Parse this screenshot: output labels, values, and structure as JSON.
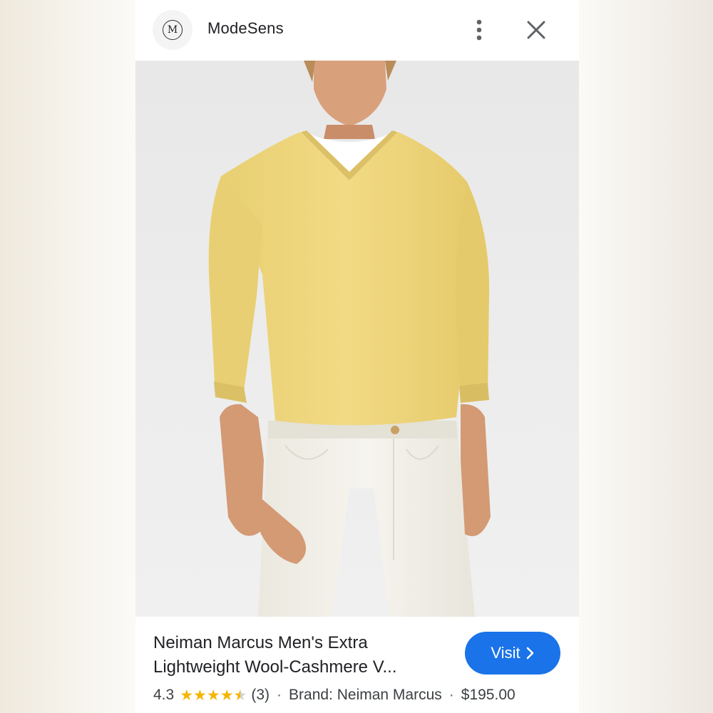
{
  "header": {
    "logo_letter": "M",
    "site_name": "ModeSens",
    "more_icon": "more-vertical-icon",
    "close_icon": "close-icon"
  },
  "product": {
    "title_line1": "Neiman Marcus Men's Extra",
    "title_line2": "Lightweight Wool-Cashmere V...",
    "rating": "4.3",
    "rating_value": 4.3,
    "rating_max": 5,
    "review_count": "(3)",
    "brand": "Brand: Neiman Marcus",
    "price": "$195.00",
    "separator": "·"
  },
  "actions": {
    "visit_label": "Visit",
    "visit_icon": "chevron-right-icon"
  },
  "colors": {
    "accent": "#1a73e8",
    "star": "#f6b400",
    "sweater": "#f0d77e",
    "jeans": "#f3f1ea"
  }
}
